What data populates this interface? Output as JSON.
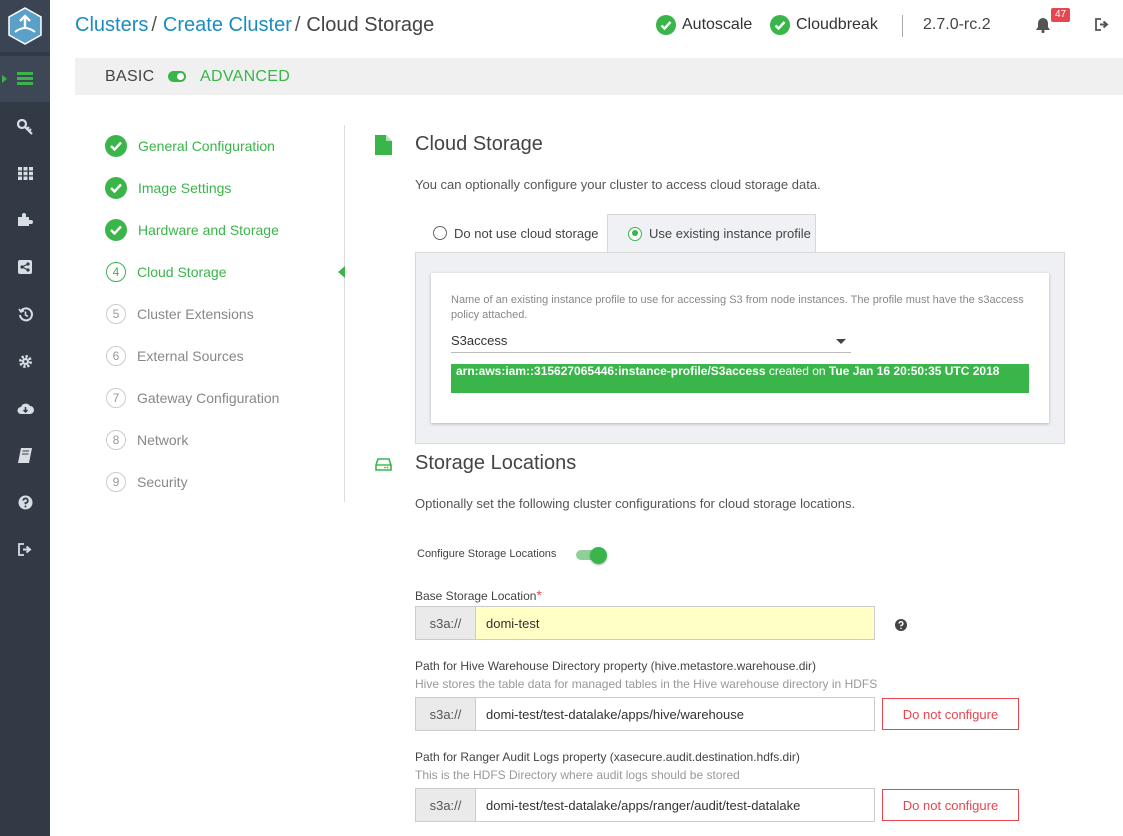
{
  "breadcrumb": {
    "items": [
      "Clusters",
      "Create Cluster",
      "Cloud Storage"
    ],
    "separator": "/"
  },
  "header": {
    "statuses": [
      {
        "label": "Autoscale",
        "icon": "check-circle-icon"
      },
      {
        "label": "Cloudbreak",
        "icon": "check-circle-icon"
      }
    ],
    "version": "2.7.0-rc.2",
    "notifications_count": "47"
  },
  "mode": {
    "basic_label": "BASIC",
    "advanced_label": "ADVANCED",
    "advanced_enabled": true
  },
  "sidebar": {
    "items": [
      {
        "name": "clusters",
        "icon": "server-list-icon",
        "active": true
      },
      {
        "name": "credentials",
        "icon": "key-icon"
      },
      {
        "name": "blueprints",
        "icon": "grid-icon"
      },
      {
        "name": "recipes",
        "icon": "puzzle-icon"
      },
      {
        "name": "shared-services",
        "icon": "share-icon"
      },
      {
        "name": "history",
        "icon": "history-icon"
      },
      {
        "name": "settings",
        "icon": "gear-icon"
      },
      {
        "name": "cloud-storage",
        "icon": "cloud-download-icon"
      },
      {
        "name": "documentation",
        "icon": "book-icon"
      },
      {
        "name": "help",
        "icon": "question-icon"
      },
      {
        "name": "logout",
        "icon": "logout-icon"
      }
    ]
  },
  "steps": [
    {
      "number": "1",
      "label": "General Configuration",
      "state": "done"
    },
    {
      "number": "2",
      "label": "Image Settings",
      "state": "done"
    },
    {
      "number": "3",
      "label": "Hardware and Storage",
      "state": "done"
    },
    {
      "number": "4",
      "label": "Cloud Storage",
      "state": "current"
    },
    {
      "number": "5",
      "label": "Cluster Extensions",
      "state": "todo"
    },
    {
      "number": "6",
      "label": "External Sources",
      "state": "todo"
    },
    {
      "number": "7",
      "label": "Gateway Configuration",
      "state": "todo"
    },
    {
      "number": "8",
      "label": "Network",
      "state": "todo"
    },
    {
      "number": "9",
      "label": "Security",
      "state": "todo"
    }
  ],
  "cloud_storage": {
    "title": "Cloud Storage",
    "description": "You can optionally configure your cluster to access cloud storage data.",
    "tabs": [
      {
        "label": "Do not use cloud storage",
        "selected": false
      },
      {
        "label": "Use existing instance profile",
        "selected": true
      }
    ],
    "profile_hint": "Name of an existing instance profile to use for accessing S3 from node instances. The profile must have the s3access policy attached.",
    "profile_value": "S3access",
    "arn_text": "arn:aws:iam::315627065446:instance-profile/S3access",
    "arn_created_prefix": "created on",
    "arn_created_date": "Tue Jan 16 20:50:35 UTC 2018"
  },
  "storage_locations": {
    "title": "Storage Locations",
    "description": "Optionally set the following cluster configurations for cloud storage locations.",
    "configure_label": "Configure Storage Locations",
    "configure_enabled": true,
    "base": {
      "label": "Base Storage Location",
      "required_mark": "*",
      "prefix": "s3a://",
      "value": "domi-test"
    },
    "hive": {
      "label": "Path for Hive Warehouse Directory property (hive.metastore.warehouse.dir)",
      "hint": "Hive stores the table data for managed tables in the Hive warehouse directory in HDFS",
      "prefix": "s3a://",
      "value": "domi-test/test-datalake/apps/hive/warehouse",
      "button": "Do not configure"
    },
    "ranger": {
      "label": "Path for Ranger Audit Logs property (xasecure.audit.destination.hdfs.dir)",
      "hint": "This is the HDFS Directory where audit logs should be stored",
      "prefix": "s3a://",
      "value": "domi-test/test-datalake/apps/ranger/audit/test-datalake",
      "button": "Do not configure"
    }
  },
  "colors": {
    "accent_green": "#3ab54a",
    "link_blue": "#1a8dc0",
    "danger_red": "#e8464f",
    "sidebar_bg": "#323a45"
  }
}
